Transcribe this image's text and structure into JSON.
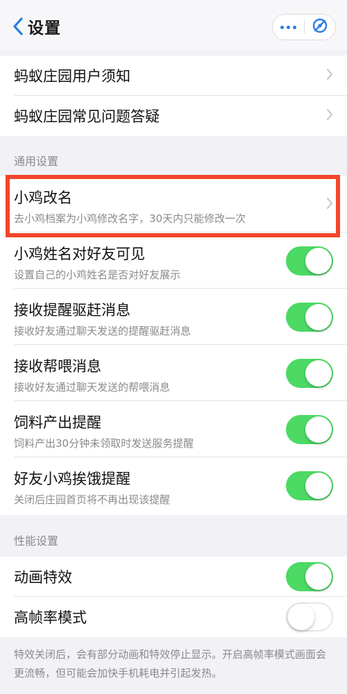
{
  "navbar": {
    "title": "设置",
    "more_icon": "more-dots-icon",
    "close_icon": "mini-program-close-icon",
    "accent": "#2a7de1"
  },
  "group1": {
    "items": [
      {
        "label": "蚂蚁庄园用户须知"
      },
      {
        "label": "蚂蚁庄园常见问题答疑"
      }
    ]
  },
  "general": {
    "header": "通用设置",
    "items": [
      {
        "label": "小鸡改名",
        "sub": "去小鸡档案为小鸡修改名字，30天内只能修改一次",
        "control": "chevron"
      },
      {
        "label": "小鸡姓名对好友可见",
        "sub": "设置自己的小鸡姓名是否对好友展示",
        "control": "toggle",
        "on": true
      },
      {
        "label": "接收提醒驱赶消息",
        "sub": "接收好友通过聊天发送的提醒驱赶消息",
        "control": "toggle",
        "on": true
      },
      {
        "label": "接收帮喂消息",
        "sub": "接收好友通过聊天发送的帮喂消息",
        "control": "toggle",
        "on": true
      },
      {
        "label": "饲料产出提醒",
        "sub": "饲料产出30分钟未领取时发送服务提醒",
        "control": "toggle",
        "on": true
      },
      {
        "label": "好友小鸡挨饿提醒",
        "sub": "关闭后庄园首页将不再出现该提醒",
        "control": "toggle",
        "on": true
      }
    ]
  },
  "performance": {
    "header": "性能设置",
    "items": [
      {
        "label": "动画特效",
        "on": true
      },
      {
        "label": "高帧率模式",
        "on": false
      }
    ],
    "note": "特效关闭后，会有部分动画和特效停止显示。开启高帧率模式画面会更流畅，但可能会加快手机耗电并引起发热。"
  },
  "colors": {
    "toggle_on": "#4cd964",
    "highlight": "#f2462a",
    "secondary_text": "#8a8a8e"
  }
}
